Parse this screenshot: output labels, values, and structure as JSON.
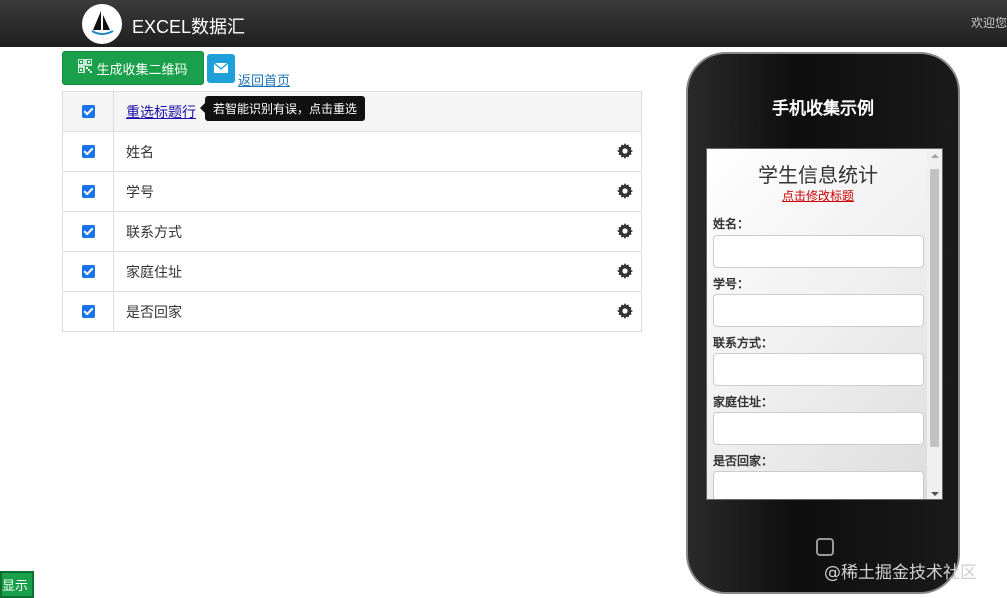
{
  "navbar": {
    "brand": "EXCEL数据汇",
    "welcome": "欢迎您"
  },
  "toolbar": {
    "qr_button_label": "生成收集二维码",
    "back_link": "返回首页"
  },
  "table": {
    "header_link": "重选标题行",
    "tooltip": "若智能识别有误，点击重选",
    "rows": [
      {
        "label": "姓名",
        "checked": true
      },
      {
        "label": "学号",
        "checked": true
      },
      {
        "label": "联系方式",
        "checked": true
      },
      {
        "label": "家庭住址",
        "checked": true
      },
      {
        "label": "是否回家",
        "checked": true
      }
    ]
  },
  "phone": {
    "title": "手机收集示例",
    "form_title": "学生信息统计",
    "edit_title_link": "点击修改标题",
    "fields": [
      "姓名：",
      "学号：",
      "联系方式：",
      "家庭住址：",
      "是否回家："
    ]
  },
  "watermark": "@稀土掘金技术社区",
  "bottom_button": "显示"
}
